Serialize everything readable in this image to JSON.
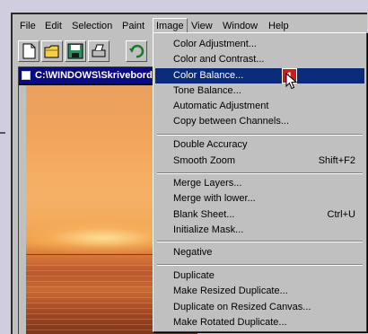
{
  "menubar": [
    {
      "label": "File",
      "active": false
    },
    {
      "label": "Edit",
      "active": false
    },
    {
      "label": "Selection",
      "active": false
    },
    {
      "label": "Paint",
      "active": false
    },
    {
      "label": "Image",
      "active": true
    },
    {
      "label": "View",
      "active": false
    },
    {
      "label": "Window",
      "active": false
    },
    {
      "label": "Help",
      "active": false
    }
  ],
  "toolbar": {
    "icons": [
      "new-document-icon",
      "open-folder-icon",
      "save-icon",
      "print-icon",
      "undo-icon"
    ]
  },
  "document": {
    "title": "C:\\WINDOWS\\Skrivebord"
  },
  "image_menu": {
    "items": [
      {
        "label": "Color Adjustment...",
        "shortcut": ""
      },
      {
        "label": "Color and Contrast...",
        "shortcut": ""
      },
      {
        "label": "Color Balance...",
        "shortcut": "",
        "highlighted": true
      },
      {
        "label": "Tone Balance...",
        "shortcut": ""
      },
      {
        "label": "Automatic Adjustment",
        "shortcut": ""
      },
      {
        "label": "Copy between Channels...",
        "shortcut": ""
      },
      {
        "label": "Double Accuracy",
        "shortcut": ""
      },
      {
        "label": "Smooth Zoom",
        "shortcut": "Shift+F2"
      },
      {
        "label": "Merge Layers...",
        "shortcut": ""
      },
      {
        "label": "Merge with lower...",
        "shortcut": ""
      },
      {
        "label": "Blank Sheet...",
        "shortcut": "Ctrl+U"
      },
      {
        "label": "Initialize Mask...",
        "shortcut": ""
      },
      {
        "label": "Negative",
        "shortcut": ""
      },
      {
        "label": "Duplicate",
        "shortcut": ""
      },
      {
        "label": "Make Resized Duplicate...",
        "shortcut": ""
      },
      {
        "label": "Duplicate on Resized Canvas...",
        "shortcut": ""
      },
      {
        "label": "Make Rotated Duplicate...",
        "shortcut": ""
      }
    ]
  },
  "callout": {
    "number": "1"
  },
  "colors": {
    "highlight": "#0a2a7a",
    "title_bar": "#0a0a84",
    "badge": "#d01a1a",
    "background": "#cfcdde"
  }
}
